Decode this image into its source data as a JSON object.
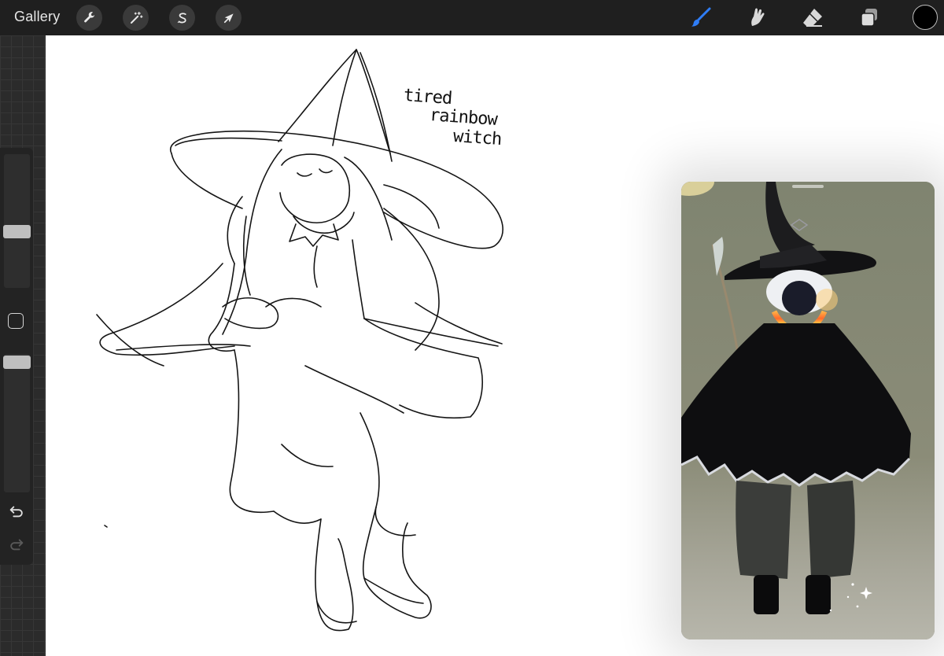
{
  "app": {
    "gallery_label": "Gallery"
  },
  "toolbar_left": [
    {
      "name": "actions",
      "icon": "wrench-icon"
    },
    {
      "name": "adjustments",
      "icon": "magic-wand-icon"
    },
    {
      "name": "selection",
      "icon": "selection-s-icon"
    },
    {
      "name": "transform",
      "icon": "arrow-cursor-icon"
    }
  ],
  "toolbar_right": [
    {
      "name": "brush",
      "icon": "brush-icon",
      "active": true
    },
    {
      "name": "smudge",
      "icon": "smudge-icon",
      "active": false
    },
    {
      "name": "eraser",
      "icon": "eraser-icon",
      "active": false
    },
    {
      "name": "layers",
      "icon": "layers-icon",
      "active": false
    }
  ],
  "colors": {
    "accent": "#2f7df6",
    "current_color": "#000000",
    "topbar": "#1f1f1f",
    "canvas": "#ffffff"
  },
  "sidebar": {
    "brush_size_level": 0.5,
    "opacity_level": 0.95,
    "modifier_icon": "square-modifier-icon",
    "undo_icon": "undo-icon",
    "redo_icon": "redo-icon"
  },
  "canvas": {
    "note_line1": "tired",
    "note_line2": "rainbow",
    "note_line3": "witch"
  },
  "reference_window": {
    "icon": "reference-image"
  }
}
